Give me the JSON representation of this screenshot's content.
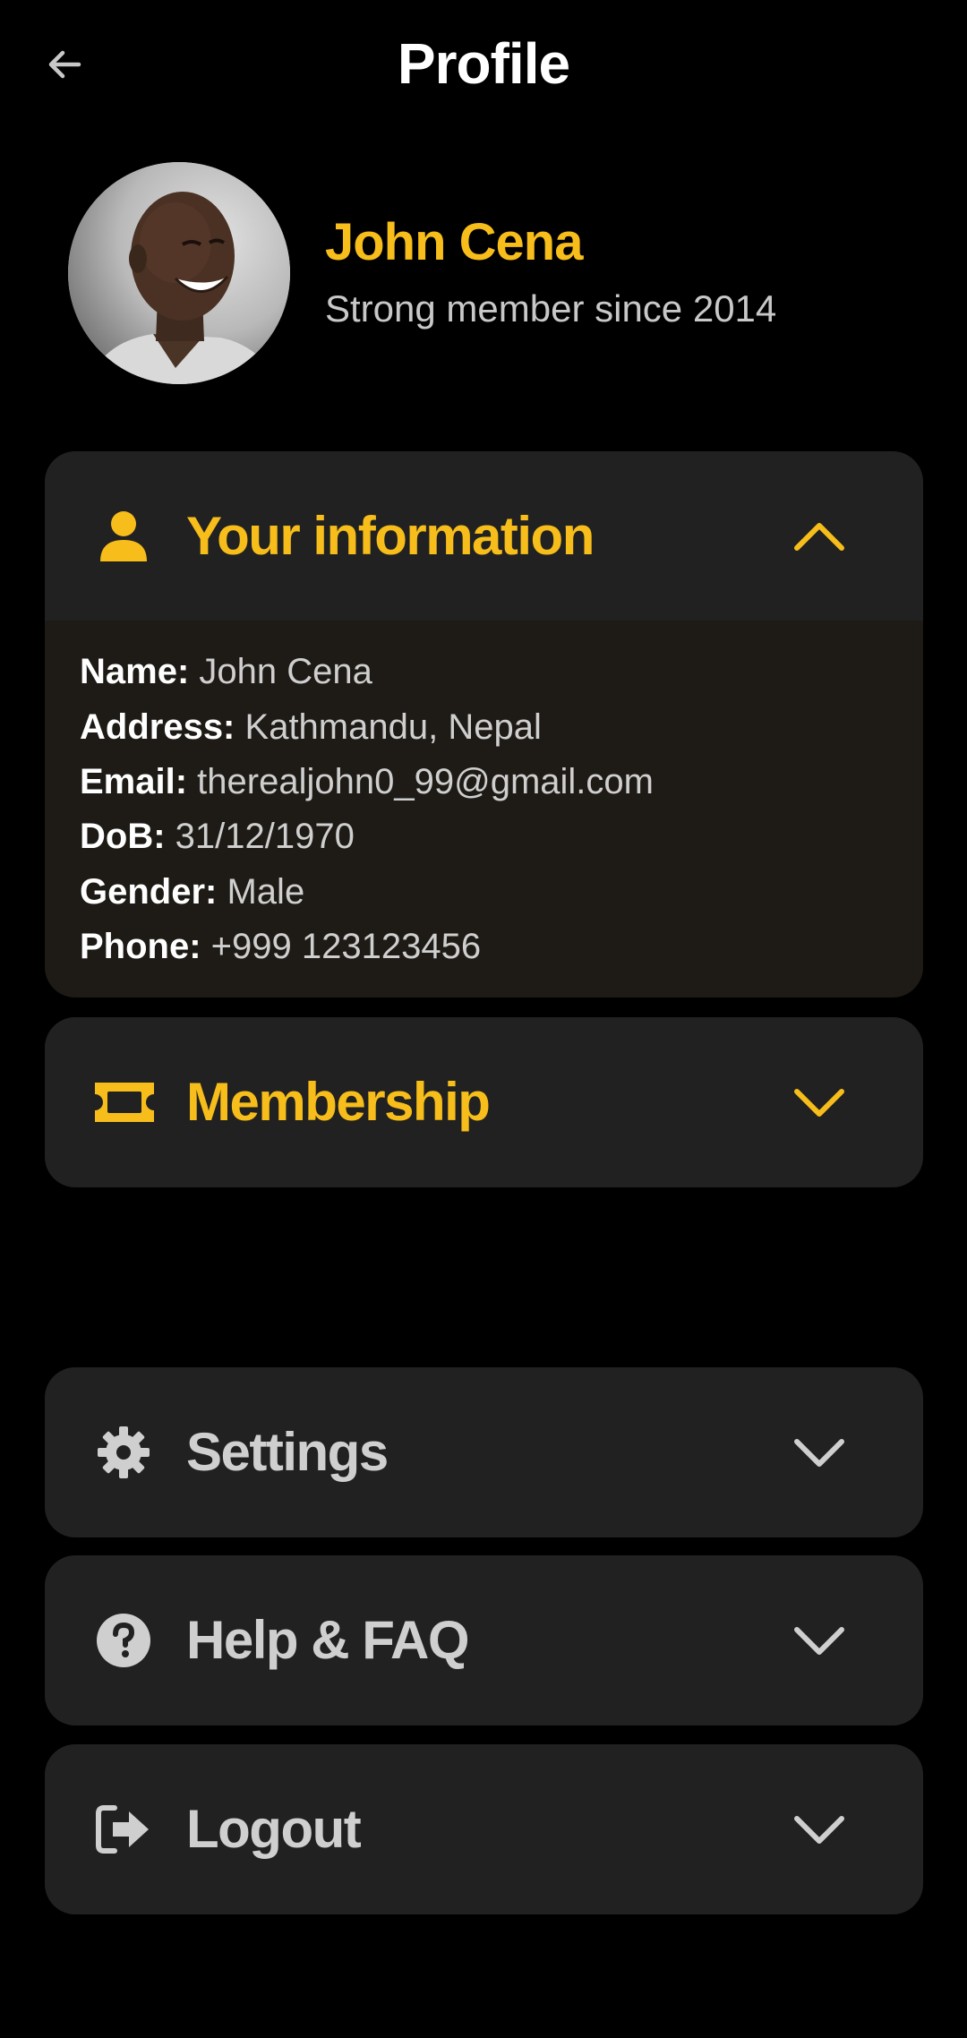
{
  "header": {
    "title": "Profile",
    "back_icon": "arrow-left-icon"
  },
  "profile": {
    "name": "John Cena",
    "subtitle": "Strong member since 2014",
    "avatar_icon": "avatar-photo"
  },
  "sections": {
    "info": {
      "title": "Your information",
      "icon": "person-icon",
      "chevron": "chevron-up-icon",
      "expanded": true,
      "fields": [
        {
          "label": "Name:",
          "value": "John Cena"
        },
        {
          "label": "Address:",
          "value": "Kathmandu, Nepal"
        },
        {
          "label": "Email:",
          "value": "therealjohn0_99@gmail.com"
        },
        {
          "label": "DoB:",
          "value": "31/12/1970"
        },
        {
          "label": "Gender:",
          "value": "Male"
        },
        {
          "label": "Phone:",
          "value": "+999 123123456"
        }
      ]
    },
    "membership": {
      "title": "Membership",
      "icon": "ticket-icon",
      "chevron": "chevron-down-icon",
      "expanded": false
    },
    "settings": {
      "title": "Settings",
      "icon": "gear-icon",
      "chevron": "chevron-down-icon",
      "expanded": false
    },
    "help": {
      "title": "Help & FAQ",
      "icon": "question-circle-icon",
      "chevron": "chevron-down-icon",
      "expanded": false
    },
    "logout": {
      "title": "Logout",
      "icon": "logout-icon",
      "chevron": "chevron-down-icon",
      "expanded": false
    }
  },
  "colors": {
    "background": "#000000",
    "card": "#212121",
    "card_expanded_body": "#1e1b16",
    "accent": "#f6bd1b",
    "muted_text": "#cfcfcf"
  }
}
